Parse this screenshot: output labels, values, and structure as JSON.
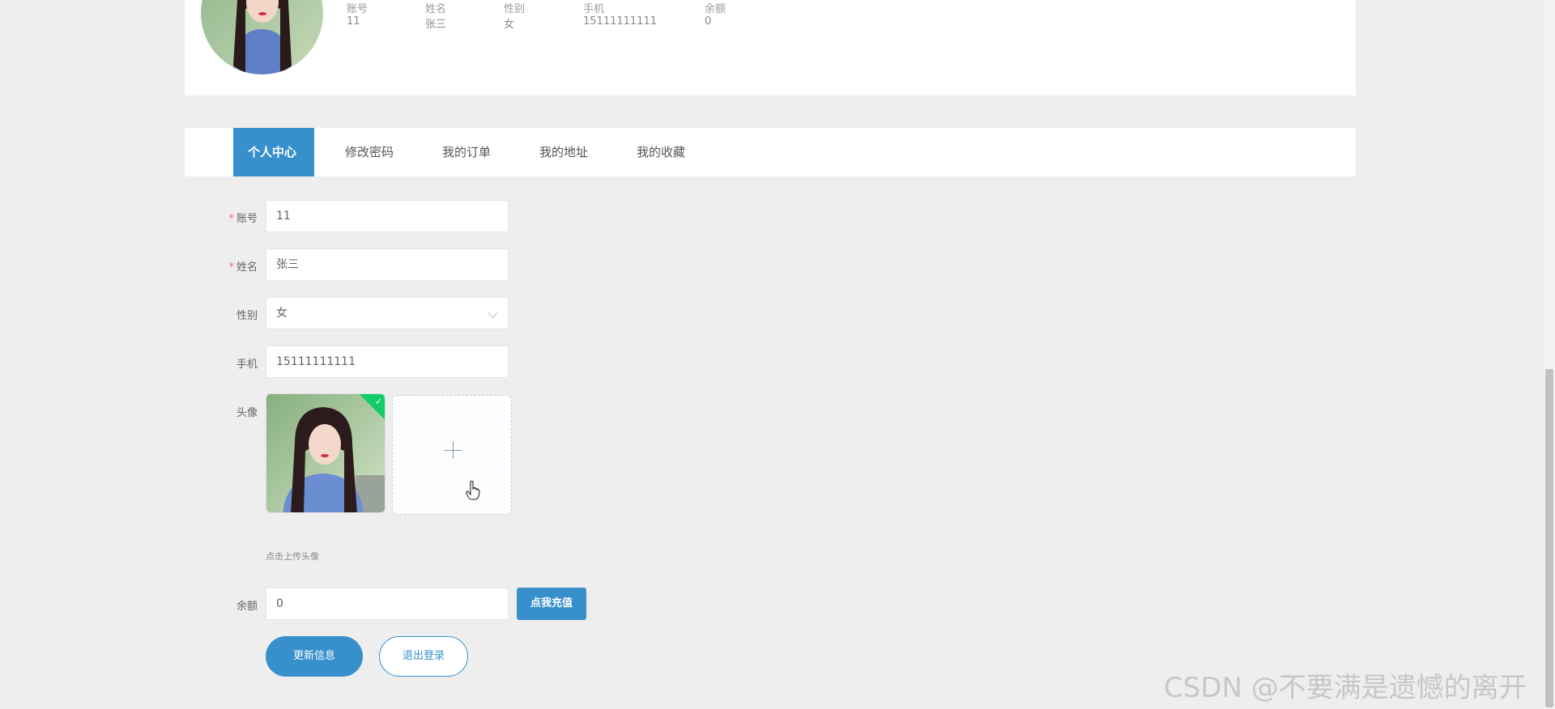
{
  "profile": {
    "columns": [
      {
        "label": "账号",
        "value": "11"
      },
      {
        "label": "姓名",
        "value": "张三"
      },
      {
        "label": "性别",
        "value": "女"
      },
      {
        "label": "手机",
        "value": "15111111111"
      },
      {
        "label": "余额",
        "value": "0"
      }
    ]
  },
  "tabs": [
    "个人中心",
    "修改密码",
    "我的订单",
    "我的地址",
    "我的收藏"
  ],
  "form": {
    "account": {
      "label": "账号",
      "value": "11"
    },
    "name": {
      "label": "姓名",
      "value": "张三"
    },
    "gender": {
      "label": "性别",
      "value": "女"
    },
    "phone": {
      "label": "手机",
      "value": "15111111111"
    },
    "avatar": {
      "label": "头像",
      "tip": "点击上传头像"
    },
    "balance": {
      "label": "余额",
      "value": "0"
    },
    "required_mark": "*"
  },
  "buttons": {
    "recharge": "点我充值",
    "update": "更新信息",
    "logout": "退出登录"
  },
  "watermark": "CSDN @不要满是遗憾的离开",
  "colors": {
    "accent": "#3790cc",
    "success": "#13ce66",
    "required": "#f56c6c"
  },
  "icons": {
    "select_arrow": "chevron-down-icon",
    "upload": "plus-icon",
    "uploaded": "check-icon",
    "cursor": "hand-pointer-icon"
  }
}
